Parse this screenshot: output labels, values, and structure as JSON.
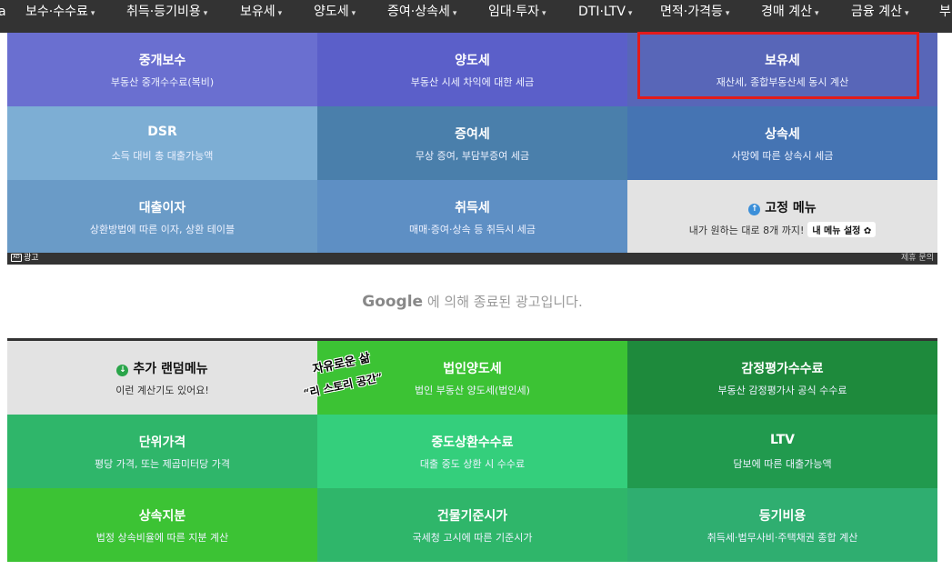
{
  "navbar": {
    "items": [
      {
        "label": "보수·수수료"
      },
      {
        "label": "취득·등기비용"
      },
      {
        "label": "보유세"
      },
      {
        "label": "양도세"
      },
      {
        "label": "증여·상속세"
      },
      {
        "label": "임대·투자"
      },
      {
        "label": "DTI·LTV"
      },
      {
        "label": "면적·가격등"
      },
      {
        "label": "경매 계산"
      },
      {
        "label": "금융 계산"
      }
    ],
    "left_edge_fragment": "a",
    "right_edge_fragment": "부",
    "caret": "▾"
  },
  "top_tiles": [
    {
      "title": "중개보수",
      "subtitle": "부동산 중개수수료(복비)",
      "color": "#6a6fd0"
    },
    {
      "title": "양도세",
      "subtitle": "부동산 시세 차익에 대한 세금",
      "color": "#5b5fc9"
    },
    {
      "title": "보유세",
      "subtitle": "재산세, 종합부동산세 동시 계산",
      "color": "#5866b8"
    },
    {
      "title": "DSR",
      "subtitle": "소득 대비 총 대출가능액",
      "color": "#7daed4"
    },
    {
      "title": "증여세",
      "subtitle": "무상 증여, 부담부증여 세금",
      "color": "#4a7fab"
    },
    {
      "title": "상속세",
      "subtitle": "사망에 따른 상속시 세금",
      "color": "#4574b3"
    },
    {
      "title": "대출이자",
      "subtitle": "상환방법에 따른 이자, 상환 테이블",
      "color": "#6a9bc7"
    },
    {
      "title": "취득세",
      "subtitle": "매매·증여·상속 등 취득시 세금",
      "color": "#5e8fc4"
    },
    {
      "title": "고정 메뉴",
      "subtitle": "내가 원하는 대로 8개 까지!",
      "color": "#e3e3e3",
      "button": "내 메뉴 설정",
      "icon": "↑",
      "gear": "✿"
    }
  ],
  "ad": {
    "label": "광고",
    "icon": "AD",
    "right_label": "제휴 문의",
    "google": "Google",
    "message": " 에 의해 종료된 광고입니다."
  },
  "bottom_tiles": [
    {
      "title": "추가 랜덤메뉴",
      "subtitle": "이런 계산기도 있어요!",
      "color": "#e3e3e3",
      "icon": "↓"
    },
    {
      "title": "법인양도세",
      "subtitle": "법인 부동산 양도세(법인세)",
      "color": "#3cc334"
    },
    {
      "title": "감정평가수수료",
      "subtitle": "부동산 감정평가사 공식 수수료",
      "color": "#1e8a3c"
    },
    {
      "title": "단위가격",
      "subtitle": "평당 가격, 또는 제곱미터당 가격",
      "color": "#2fb66a"
    },
    {
      "title": "중도상환수수료",
      "subtitle": "대출 중도 상환 시 수수료",
      "color": "#34cf7c"
    },
    {
      "title": "LTV",
      "subtitle": "담보에 따른 대출가능액",
      "color": "#219a4e"
    },
    {
      "title": "상속지분",
      "subtitle": "법정 상속비율에 따른 지분 계산",
      "color": "#3cc334"
    },
    {
      "title": "건물기준시가",
      "subtitle": "국세청 고시에 따른 기준시가",
      "color": "#2fb66a"
    },
    {
      "title": "등기비용",
      "subtitle": "취득세·법무사비·주택채권 종합 계산",
      "color": "#2fae70"
    }
  ],
  "sticker": {
    "line1": "자유로운 삶",
    "line2": "“리 스토리 공간”"
  }
}
